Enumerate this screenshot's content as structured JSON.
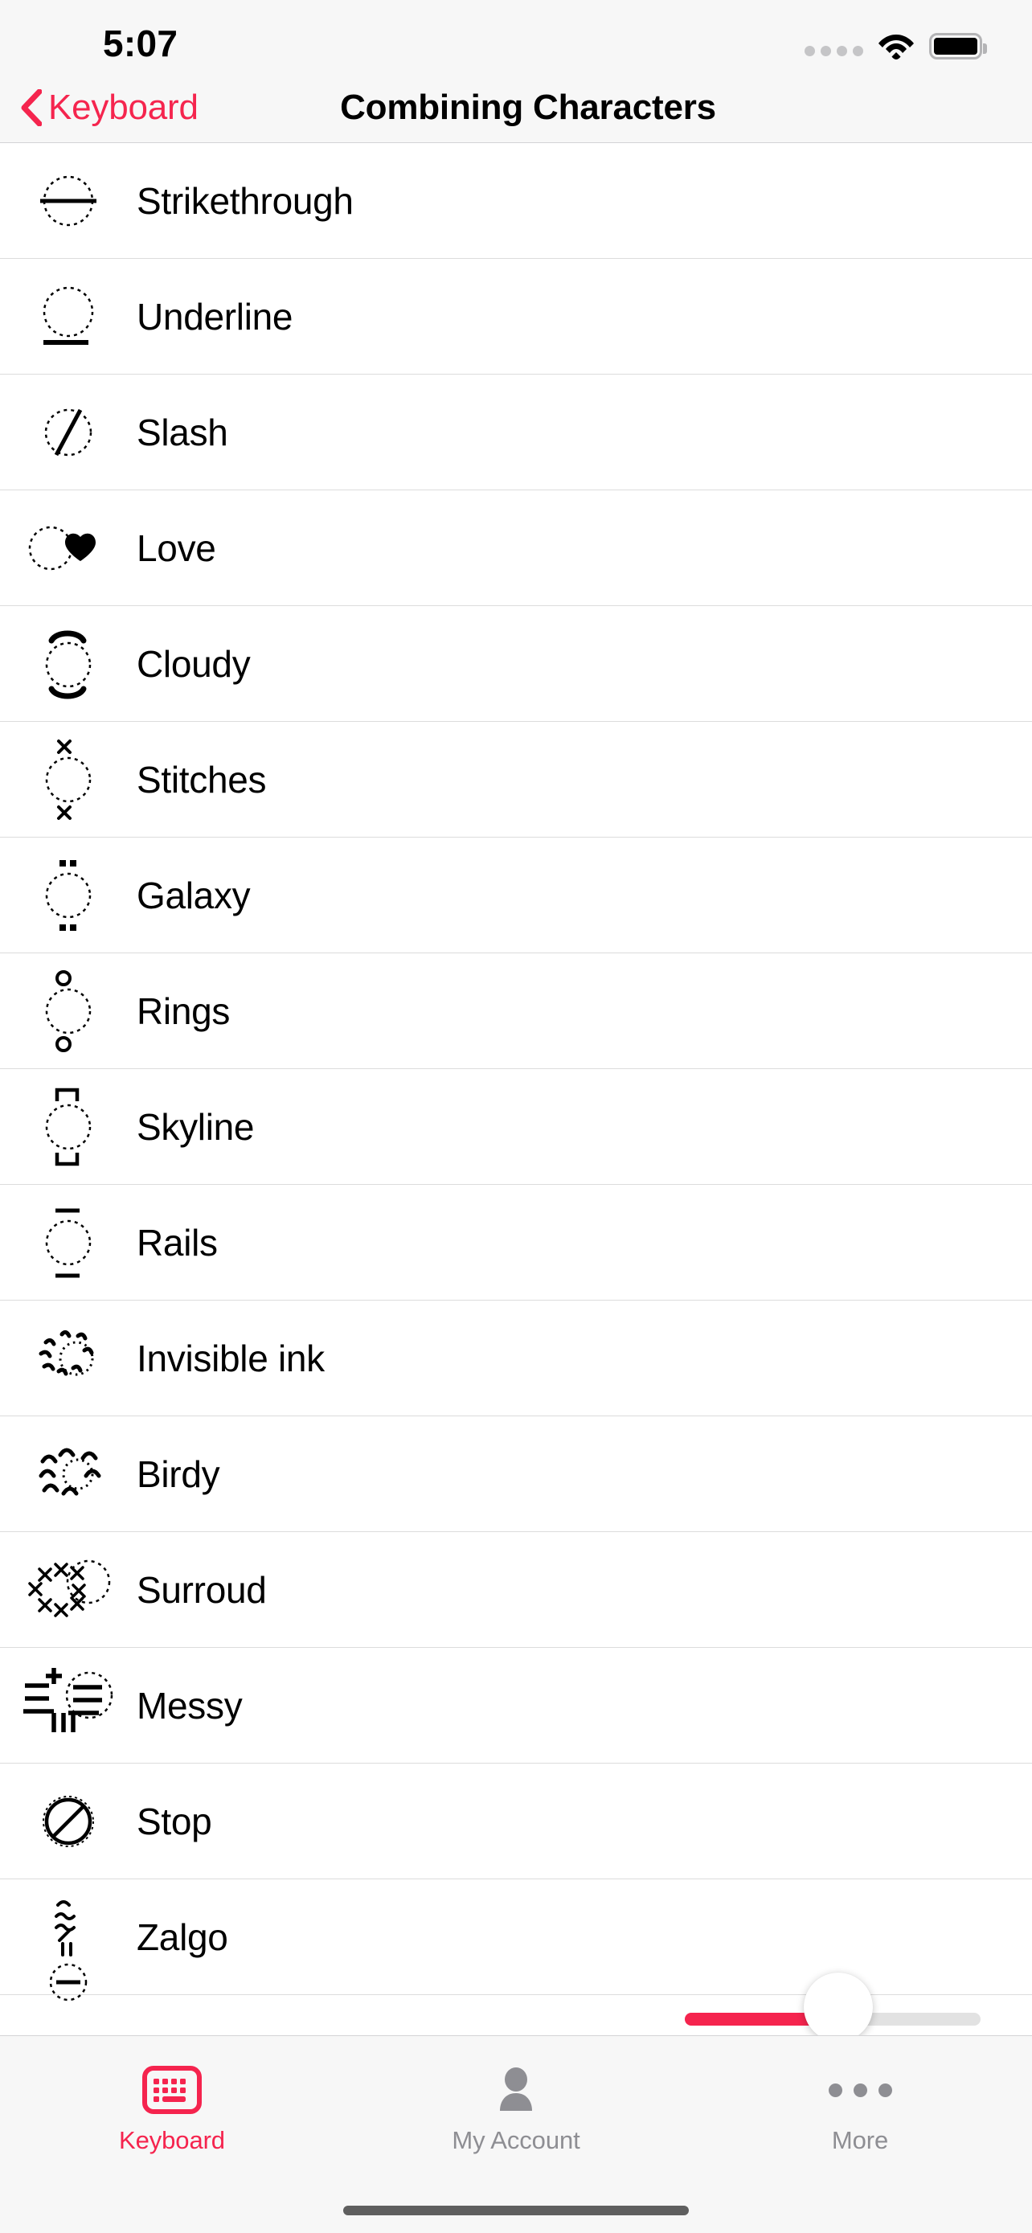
{
  "status_bar": {
    "time": "5:07",
    "cell_icon": "cellular-dots-icon",
    "wifi_icon": "wifi-icon",
    "battery_icon": "battery-full-icon"
  },
  "nav_bar": {
    "back_icon": "chevron-left-icon",
    "back_label": "Keyboard",
    "title": "Combining Characters"
  },
  "list": {
    "rows": [
      {
        "label": "Strikethrough",
        "glyph_name": "combining-strikethrough-glyph"
      },
      {
        "label": "Underline",
        "glyph_name": "combining-underline-glyph"
      },
      {
        "label": "Slash",
        "glyph_name": "combining-slash-glyph"
      },
      {
        "label": "Love",
        "glyph_name": "combining-heart-glyph"
      },
      {
        "label": "Cloudy",
        "glyph_name": "combining-arcs-glyph"
      },
      {
        "label": "Stitches",
        "glyph_name": "combining-x-above-below-glyph"
      },
      {
        "label": "Galaxy",
        "glyph_name": "combining-double-dots-glyph"
      },
      {
        "label": "Rings",
        "glyph_name": "combining-rings-glyph"
      },
      {
        "label": "Skyline",
        "glyph_name": "combining-brackets-glyph"
      },
      {
        "label": "Rails",
        "glyph_name": "combining-macron-glyph"
      },
      {
        "label": "Invisible ink",
        "glyph_name": "combining-sparkle-glyph"
      },
      {
        "label": "Birdy",
        "glyph_name": "combining-breve-cluster-glyph"
      },
      {
        "label": "Surroud",
        "glyph_name": "combining-x-cluster-glyph"
      },
      {
        "label": "Messy",
        "glyph_name": "combining-messy-glyph"
      },
      {
        "label": "Stop",
        "glyph_name": "combining-prohibition-glyph"
      },
      {
        "label": "Zalgo",
        "glyph_name": "combining-zalgo-glyph"
      }
    ]
  },
  "slider": {
    "name": "intensity-slider",
    "fill_percent": 48,
    "fill_color": "#F5244E",
    "track_color": "#E2E2E2"
  },
  "tab_bar": {
    "tabs": [
      {
        "label": "Keyboard",
        "icon": "keyboard-icon",
        "active": true
      },
      {
        "label": "My Account",
        "icon": "person-icon",
        "active": false
      },
      {
        "label": "More",
        "icon": "ellipsis-icon",
        "active": false
      }
    ]
  },
  "theme": {
    "accent": "#F5244E",
    "bar_background": "#F7F7F7",
    "separator": "#DCDCDC",
    "inactive_tab": "#8E8E93"
  }
}
